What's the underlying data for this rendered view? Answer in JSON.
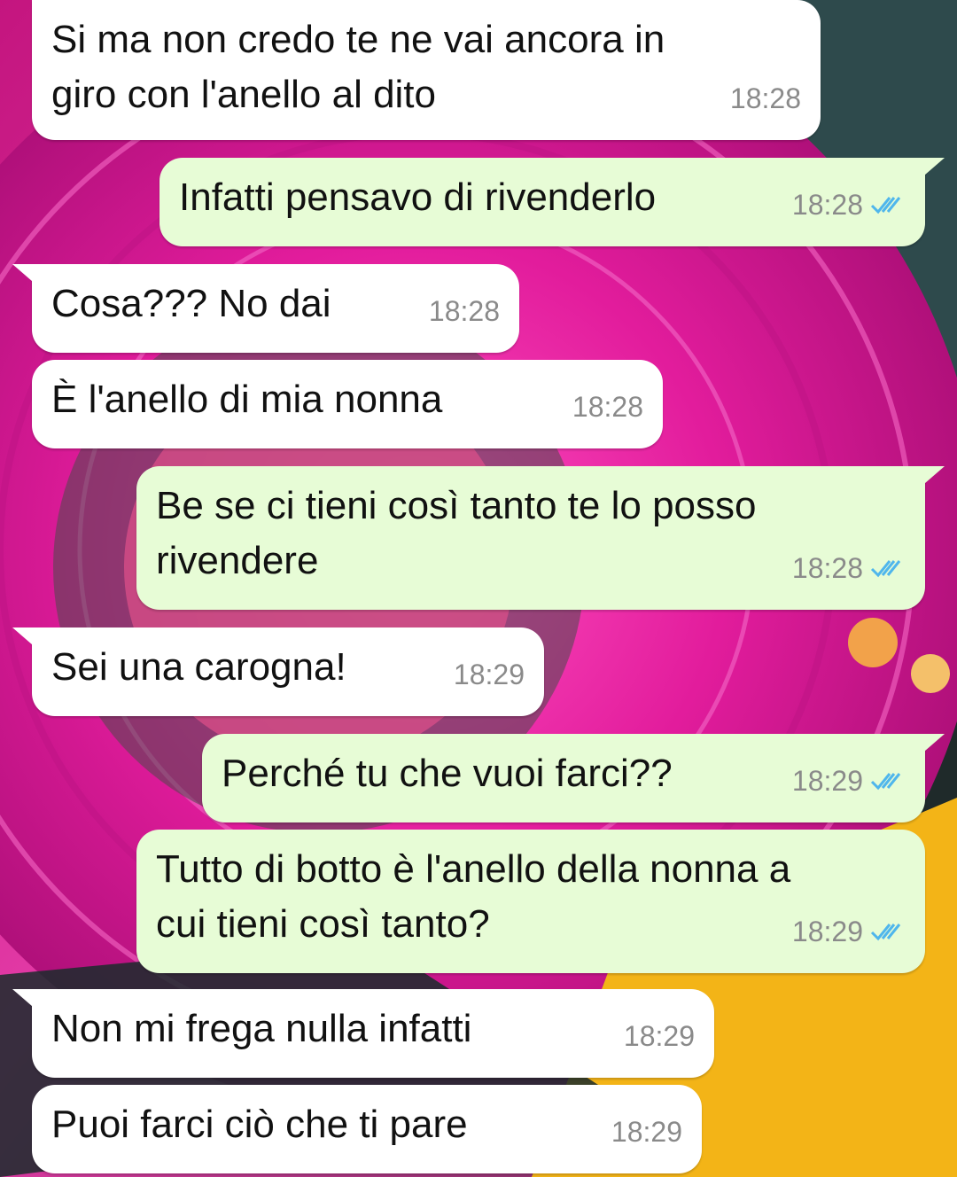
{
  "chat": {
    "messages": [
      {
        "dir": "in",
        "text": "Si ma non credo te ne vai ancora in\ngiro con l'anello al dito",
        "time": "18:28"
      },
      {
        "dir": "out",
        "text": "Infatti pensavo di rivenderlo",
        "time": "18:28",
        "status": "read"
      },
      {
        "dir": "in",
        "text": "Cosa??? No dai",
        "time": "18:28"
      },
      {
        "dir": "in",
        "text": "È l'anello di mia nonna",
        "time": "18:28"
      },
      {
        "dir": "out",
        "text": "Be se ci tieni così tanto te lo posso\nrivendere",
        "time": "18:28",
        "status": "read"
      },
      {
        "dir": "in",
        "text": "Sei una carogna!",
        "time": "18:29"
      },
      {
        "dir": "out",
        "text": "Perché tu che vuoi farci??",
        "time": "18:29",
        "status": "read"
      },
      {
        "dir": "out",
        "text": "Tutto di botto è l'anello della nonna a\ncui tieni così tanto?",
        "time": "18:29",
        "status": "read"
      },
      {
        "dir": "in",
        "text": "Non mi frega nulla infatti",
        "time": "18:29"
      },
      {
        "dir": "in",
        "text": "Puoi farci ciò che ti pare",
        "time": "18:29"
      }
    ]
  },
  "colors": {
    "incoming_bubble": "#ffffff",
    "outgoing_bubble": "#e7fcd6",
    "read_check": "#4fb6ec",
    "timestamp": "#8a8a8a"
  }
}
